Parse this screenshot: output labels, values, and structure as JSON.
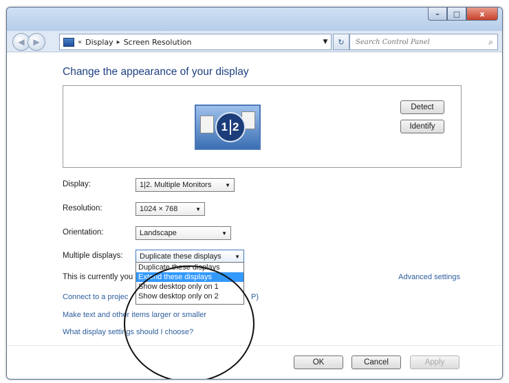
{
  "window": {
    "caption": {
      "minimize": "–",
      "maximize": "□",
      "close": "x"
    }
  },
  "nav": {
    "back": "◀",
    "forward": "▶",
    "breadcrumb": {
      "prefix": "«",
      "items": [
        "Display",
        "Screen Resolution"
      ],
      "separator": "▸"
    },
    "refresh": "↻",
    "search_placeholder": "Search Control Panel",
    "search_glyph": "⌕"
  },
  "main": {
    "heading": "Change the appearance of your display",
    "preview": {
      "badge_left": "1",
      "badge_right": "2"
    },
    "detect_label": "Detect",
    "identify_label": "Identify",
    "display": {
      "label": "Display:",
      "value": "1|2. Multiple Monitors"
    },
    "resolution": {
      "label": "Resolution:",
      "value": "1024 × 768"
    },
    "orientation": {
      "label": "Orientation:",
      "value": "Landscape"
    },
    "multiple": {
      "label": "Multiple displays:",
      "value": "Duplicate these displays",
      "options": [
        "Duplicate these displays",
        "Extend these displays",
        "Show desktop only on 1",
        "Show desktop only on 2"
      ],
      "selected_index": 1
    },
    "status_text": "This is currently you",
    "advanced_link": "Advanced settings",
    "links": {
      "connect": "Connect to a projec",
      "connect_tail": "P)",
      "bigger": "Make text and other items larger or smaller",
      "which": "What display settings should I choose?"
    }
  },
  "footer": {
    "ok": "OK",
    "cancel": "Cancel",
    "apply": "Apply"
  },
  "arrow_glyph": "▼"
}
